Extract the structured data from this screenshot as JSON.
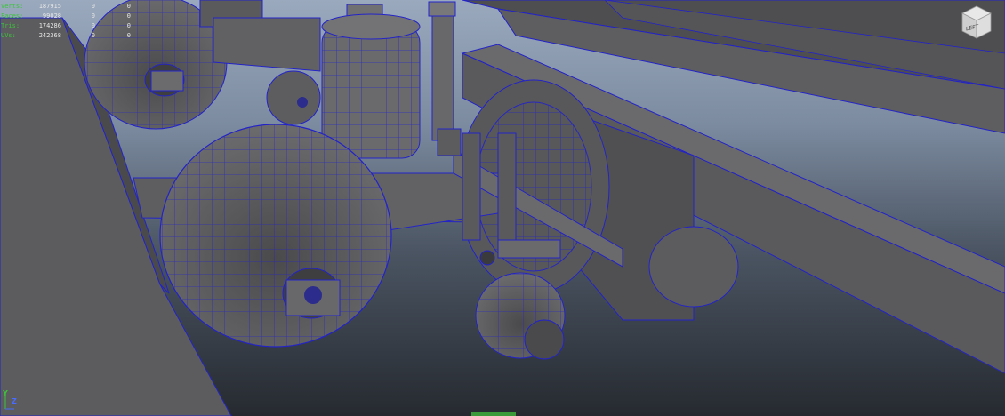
{
  "hud": {
    "rows": [
      {
        "label": "Verts:",
        "value": "187915",
        "c1": "0",
        "c2": "0"
      },
      {
        "label": "Faces:",
        "value": "99028",
        "c1": "0",
        "c2": "0"
      },
      {
        "label": "Tris:",
        "value": "174286",
        "c1": "0",
        "c2": "0"
      },
      {
        "label": "UVs:",
        "value": "242368",
        "c1": "0",
        "c2": "0"
      }
    ]
  },
  "viewcube": {
    "label": "LEFT"
  },
  "axis": {
    "y": "Y",
    "z": "Z"
  },
  "colors": {
    "hud_label": "#3cc43c",
    "wireframe": "#2a2ae0",
    "surface": "#5a5a5c"
  }
}
